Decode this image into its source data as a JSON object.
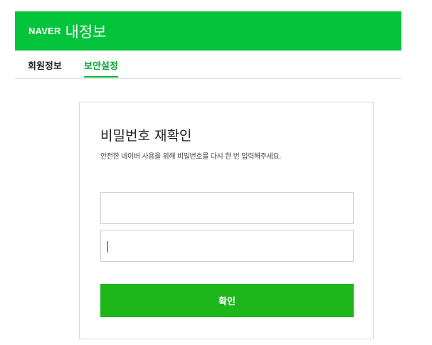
{
  "header": {
    "logo_text": "NAVER",
    "title": "내정보",
    "background_color": "#03c33b"
  },
  "tabs": [
    {
      "label": "회원정보",
      "active": false
    },
    {
      "label": "보안설정",
      "active": true
    }
  ],
  "card": {
    "title": "비밀번호 재확인",
    "description": "안전한 네이버 사용을 위해 비밀번호를 다시 한 번 입력해주세요.",
    "fields": [
      {
        "value": "",
        "placeholder": ""
      },
      {
        "value": "",
        "placeholder": "",
        "focused": true
      }
    ],
    "confirm_label": "확인",
    "confirm_color": "#1fb61a"
  }
}
